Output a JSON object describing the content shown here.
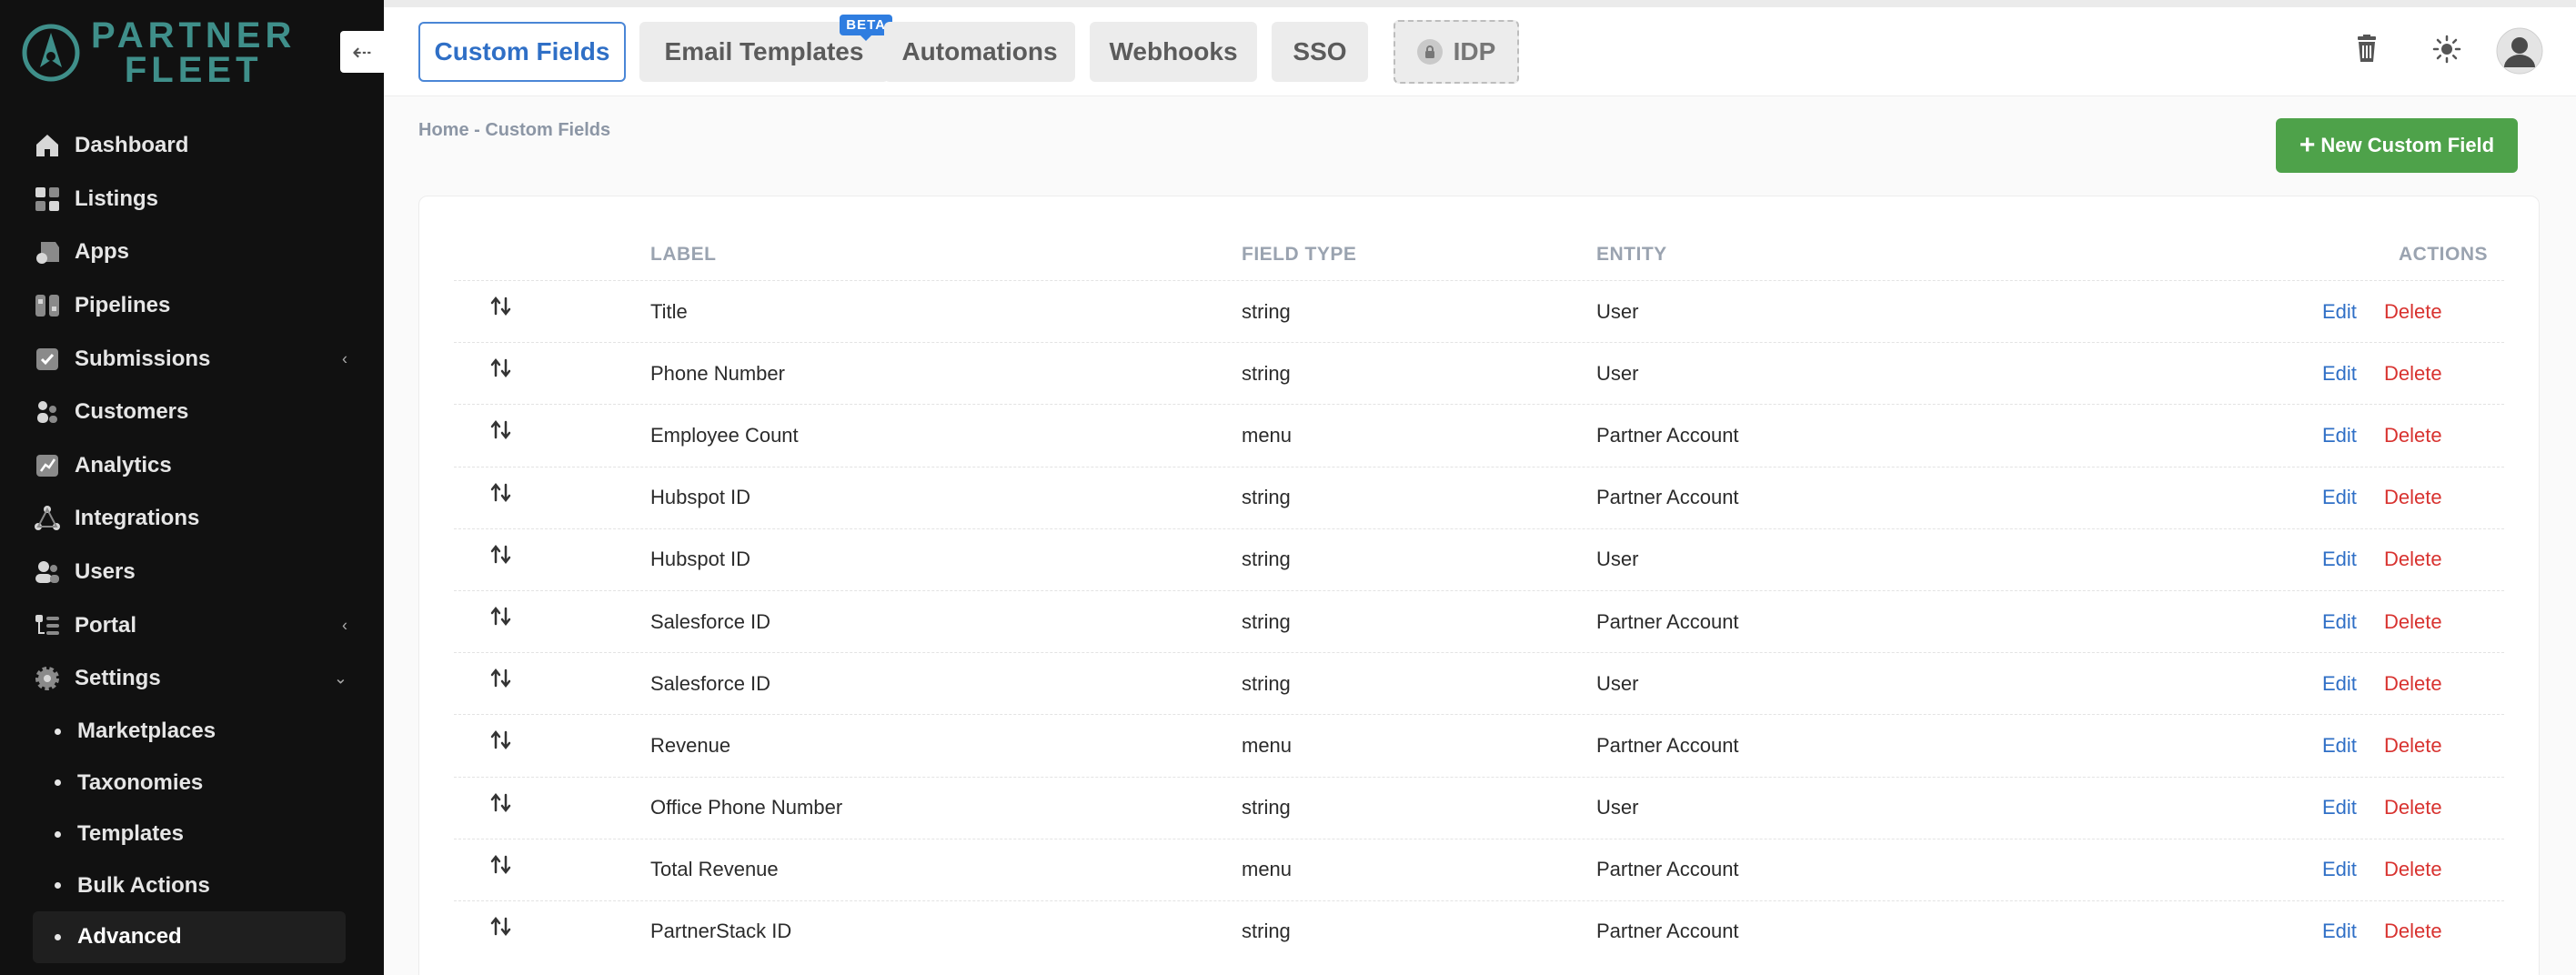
{
  "brand": {
    "line1": "PARTNER",
    "line2": "FLEET",
    "color": "#3f8f8a"
  },
  "sidebar": {
    "items": [
      {
        "label": "Dashboard",
        "icon": "home-icon"
      },
      {
        "label": "Listings",
        "icon": "grid-icon"
      },
      {
        "label": "Apps",
        "icon": "apps-icon"
      },
      {
        "label": "Pipelines",
        "icon": "pipeline-icon"
      },
      {
        "label": "Submissions",
        "icon": "check-icon",
        "caret": "‹"
      },
      {
        "label": "Customers",
        "icon": "customers-icon"
      },
      {
        "label": "Analytics",
        "icon": "chart-icon"
      },
      {
        "label": "Integrations",
        "icon": "network-icon"
      },
      {
        "label": "Users",
        "icon": "users-icon"
      },
      {
        "label": "Portal",
        "icon": "portal-icon",
        "caret": "‹"
      },
      {
        "label": "Settings",
        "icon": "gear-icon",
        "caret": "⌄"
      }
    ],
    "sub_items": [
      {
        "label": "Marketplaces"
      },
      {
        "label": "Taxonomies"
      },
      {
        "label": "Templates"
      },
      {
        "label": "Bulk Actions"
      },
      {
        "label": "Advanced"
      }
    ]
  },
  "tabs": [
    {
      "label": "Custom Fields"
    },
    {
      "label": "Email Templates",
      "badge": "BETA"
    },
    {
      "label": "Automations"
    },
    {
      "label": "Webhooks"
    },
    {
      "label": "SSO"
    },
    {
      "label": "IDP"
    }
  ],
  "breadcrumb": "Home - Custom Fields",
  "new_button": {
    "plus": "+",
    "label": "New Custom Field"
  },
  "table": {
    "headers": {
      "label": "LABEL",
      "field_type": "FIELD TYPE",
      "entity": "ENTITY",
      "actions": "ACTIONS"
    },
    "edit": "Edit",
    "delete": "Delete",
    "rows": [
      {
        "label": "Title",
        "type": "string",
        "entity": "User"
      },
      {
        "label": "Phone Number",
        "type": "string",
        "entity": "User"
      },
      {
        "label": "Employee Count",
        "type": "menu",
        "entity": "Partner Account"
      },
      {
        "label": "Hubspot ID",
        "type": "string",
        "entity": "Partner Account"
      },
      {
        "label": "Hubspot ID",
        "type": "string",
        "entity": "User"
      },
      {
        "label": "Salesforce ID",
        "type": "string",
        "entity": "Partner Account"
      },
      {
        "label": "Salesforce ID",
        "type": "string",
        "entity": "User"
      },
      {
        "label": "Revenue",
        "type": "menu",
        "entity": "Partner Account"
      },
      {
        "label": "Office Phone Number",
        "type": "string",
        "entity": "User"
      },
      {
        "label": "Total Revenue",
        "type": "menu",
        "entity": "Partner Account"
      },
      {
        "label": "PartnerStack ID",
        "type": "string",
        "entity": "Partner Account"
      }
    ]
  },
  "colors": {
    "accent": "#2f6fc6",
    "success": "#4ea24a",
    "danger": "#d8322f",
    "sidebar_bg": "#111111"
  }
}
